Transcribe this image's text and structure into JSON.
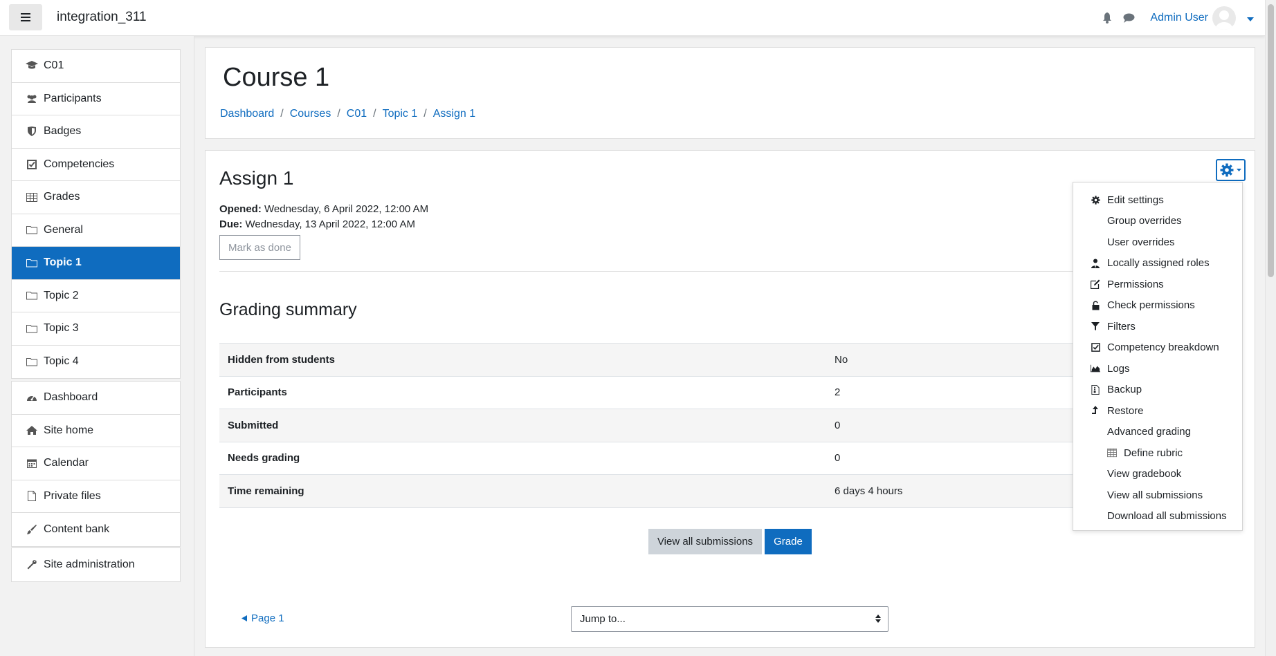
{
  "navbar": {
    "site_name": "integration_311",
    "user_name": "Admin User",
    "icons": [
      "hamburger-icon",
      "bell-icon",
      "chat-icon",
      "avatar",
      "caret-down-icon"
    ]
  },
  "drawer": {
    "course_items": [
      {
        "label": "C01",
        "icon": "graduation-cap-icon"
      },
      {
        "label": "Participants",
        "icon": "users-icon"
      },
      {
        "label": "Badges",
        "icon": "shield-icon"
      },
      {
        "label": "Competencies",
        "icon": "check-square-icon"
      },
      {
        "label": "Grades",
        "icon": "table-icon"
      },
      {
        "label": "General",
        "icon": "folder-icon"
      },
      {
        "label": "Topic 1",
        "icon": "folder-icon",
        "active": true
      },
      {
        "label": "Topic 2",
        "icon": "folder-icon"
      },
      {
        "label": "Topic 3",
        "icon": "folder-icon"
      },
      {
        "label": "Topic 4",
        "icon": "folder-icon"
      }
    ],
    "site_items": [
      {
        "label": "Dashboard",
        "icon": "dashboard-icon"
      },
      {
        "label": "Site home",
        "icon": "home-icon"
      },
      {
        "label": "Calendar",
        "icon": "calendar-icon"
      },
      {
        "label": "Private files",
        "icon": "file-icon"
      },
      {
        "label": "Content bank",
        "icon": "brush-icon"
      }
    ],
    "admin_items": [
      {
        "label": "Site administration",
        "icon": "wrench-icon"
      }
    ]
  },
  "header": {
    "title": "Course 1",
    "breadcrumb": [
      "Dashboard",
      "Courses",
      "C01",
      "Topic 1",
      "Assign 1"
    ]
  },
  "assignment": {
    "title": "Assign 1",
    "opened_label": "Opened:",
    "opened_value": "Wednesday, 6 April 2022, 12:00 AM",
    "due_label": "Due:",
    "due_value": "Wednesday, 13 April 2022, 12:00 AM",
    "mark_done_label": "Mark as done"
  },
  "grading": {
    "title": "Grading summary",
    "rows": [
      {
        "label": "Hidden from students",
        "value": "No"
      },
      {
        "label": "Participants",
        "value": "2"
      },
      {
        "label": "Submitted",
        "value": "0"
      },
      {
        "label": "Needs grading",
        "value": "0"
      },
      {
        "label": "Time remaining",
        "value": "6 days 4 hours"
      }
    ],
    "view_all_label": "View all submissions",
    "grade_label": "Grade"
  },
  "footer_nav": {
    "prev_label": "Page 1",
    "jump_placeholder": "Jump to..."
  },
  "settings_menu": {
    "items": [
      {
        "label": "Edit settings",
        "icon": "gear-icon"
      },
      {
        "label": "Group overrides",
        "icon": ""
      },
      {
        "label": "User overrides",
        "icon": ""
      },
      {
        "label": "Locally assigned roles",
        "icon": "user-tie-icon"
      },
      {
        "label": "Permissions",
        "icon": "edit-icon"
      },
      {
        "label": "Check permissions",
        "icon": "unlock-icon"
      },
      {
        "label": "Filters",
        "icon": "filter-icon"
      },
      {
        "label": "Competency breakdown",
        "icon": "check-square-icon"
      },
      {
        "label": "Logs",
        "icon": "area-chart-icon"
      },
      {
        "label": "Backup",
        "icon": "file-zip-icon"
      },
      {
        "label": "Restore",
        "icon": "level-up-icon"
      },
      {
        "label": "Advanced grading",
        "icon": ""
      },
      {
        "label": "Define rubric",
        "icon": "grid-icon",
        "sub": true
      },
      {
        "label": "View gradebook",
        "icon": ""
      },
      {
        "label": "View all submissions",
        "icon": ""
      },
      {
        "label": "Download all submissions",
        "icon": ""
      }
    ]
  },
  "colors": {
    "accent": "#0f6cbf",
    "page_bg": "#f2f2f2",
    "text": "#1d2125",
    "secondary_button": "#ced4da"
  }
}
